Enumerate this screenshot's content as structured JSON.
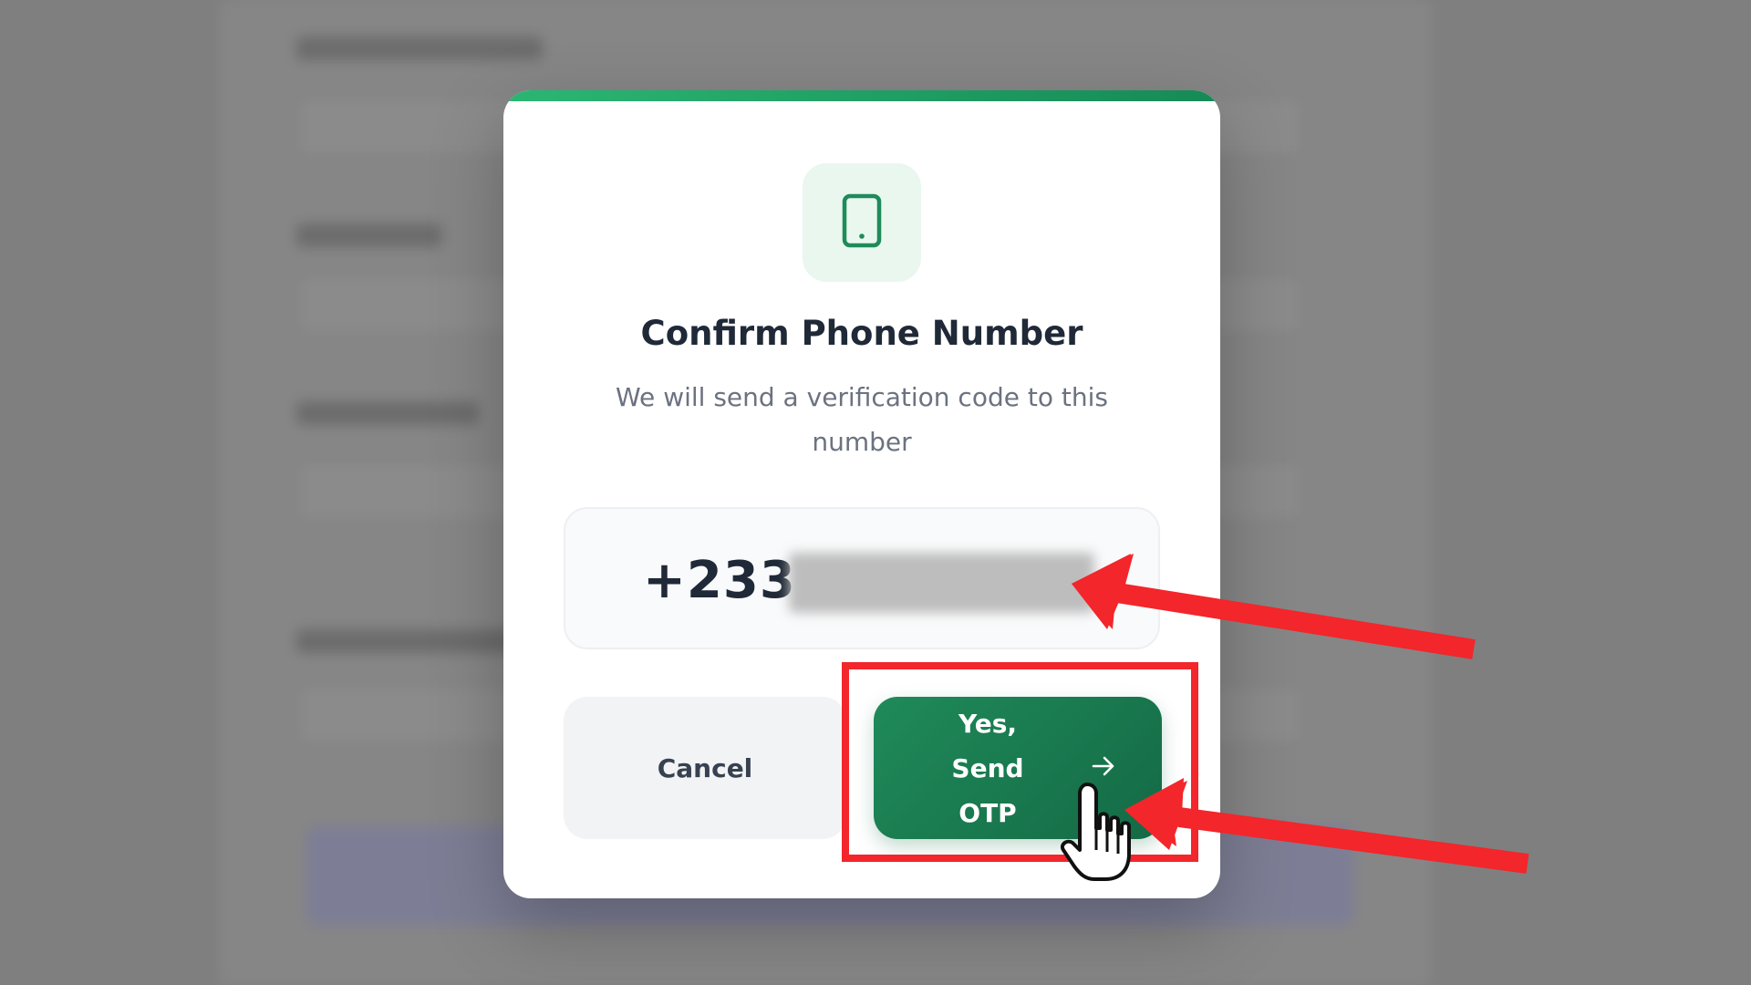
{
  "dialog": {
    "icon": "smartphone-icon",
    "title": "Confirm Phone Number",
    "subtitle": "We will send a verification code to this number",
    "phone_prefix": "+233",
    "phone_rest_redacted": true
  },
  "buttons": {
    "cancel_label": "Cancel",
    "send_label": "Yes, Send OTP",
    "send_icon": "arrow-right-icon"
  },
  "annotations": {
    "highlight_target": "send-otp-button",
    "arrow_targets": [
      "phone-number-display",
      "send-otp-button"
    ],
    "cursor": "hand-pointer-icon",
    "color": "#f2262b"
  },
  "colors": {
    "accent": "#1f8a5a",
    "accent_dark": "#146a45",
    "icon_tile_bg": "#e9f7ef",
    "overlay": "#7f7f7f"
  }
}
